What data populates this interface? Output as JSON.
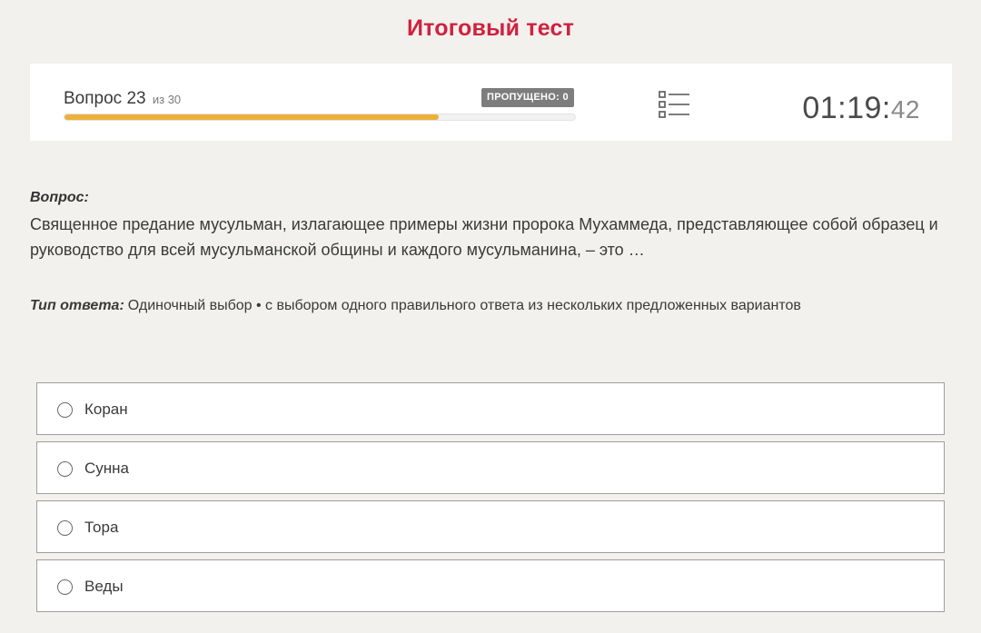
{
  "page": {
    "title": "Итоговый тест"
  },
  "status": {
    "question_label": "Вопрос 23",
    "question_total": "из 30",
    "skipped_label": "ПРОПУЩЕНО: 0",
    "progress_fraction": 0.733,
    "timer_main": "01:19:",
    "timer_seconds": "42"
  },
  "question": {
    "label": "Вопрос:",
    "text": "Священное предание мусульман, излагающее примеры жизни пророка Мухаммеда, представляющее собой образец и руководство для всей мусульманской общины и каждого мусульманина, – это …",
    "answer_type_label": "Тип ответа:",
    "answer_type_value": "Одиночный выбор • с выбором одного правильного ответа из нескольких предложенных вариантов"
  },
  "options": [
    {
      "label": "Коран",
      "selected": false
    },
    {
      "label": "Сунна",
      "selected": false
    },
    {
      "label": "Тора",
      "selected": false
    },
    {
      "label": "Веды",
      "selected": false
    }
  ],
  "icons": {
    "question_list": "list-icon",
    "radio": "radio-button"
  },
  "colors": {
    "title": "#d0213f",
    "progress": "#ecb13a",
    "badge": "#7d7d7d",
    "background": "#f2f1ed"
  }
}
